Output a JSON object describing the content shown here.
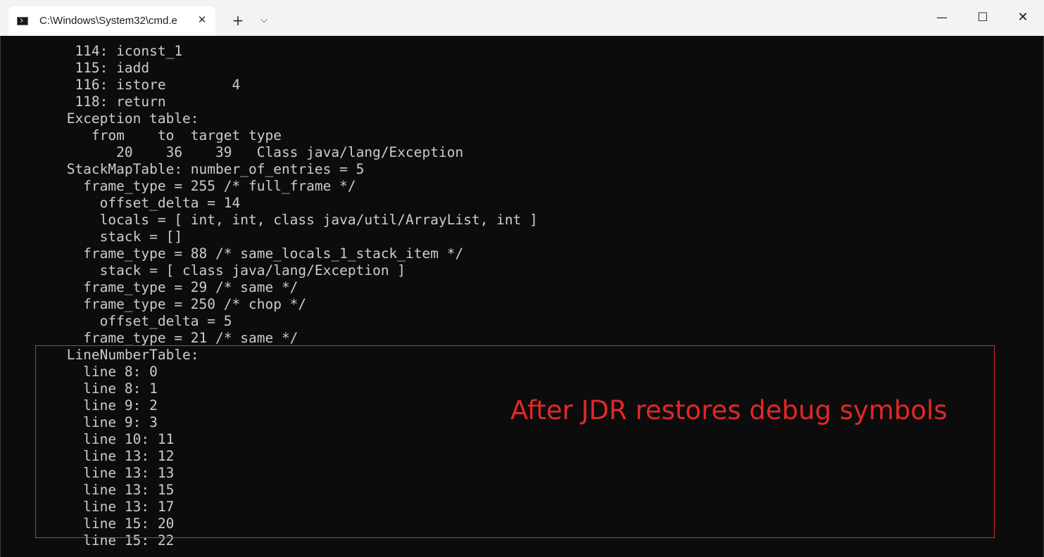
{
  "titlebar": {
    "tab_title": "C:\\Windows\\System32\\cmd.e",
    "tab_close_glyph": "✕",
    "new_tab_glyph": "+",
    "dropdown_glyph": "⌵",
    "minimize_glyph": "—",
    "maximize_glyph": "☐",
    "close_glyph": "✕"
  },
  "terminal": {
    "lines": [
      "      114: iconst_1",
      "      115: iadd",
      "      116: istore        4",
      "      118: return",
      "     Exception table:",
      "        from    to  target type",
      "           20    36    39   Class java/lang/Exception",
      "     StackMapTable: number_of_entries = 5",
      "       frame_type = 255 /* full_frame */",
      "         offset_delta = 14",
      "         locals = [ int, int, class java/util/ArrayList, int ]",
      "         stack = []",
      "       frame_type = 88 /* same_locals_1_stack_item */",
      "         stack = [ class java/lang/Exception ]",
      "       frame_type = 29 /* same */",
      "       frame_type = 250 /* chop */",
      "         offset_delta = 5",
      "       frame_type = 21 /* same */",
      "     LineNumberTable:",
      "       line 8: 0",
      "       line 8: 1",
      "       line 9: 2",
      "       line 9: 3",
      "       line 10: 11",
      "       line 13: 12",
      "       line 13: 13",
      "       line 13: 15",
      "       line 13: 17",
      "       line 15: 20",
      "       line 15: 22"
    ]
  },
  "annotation": {
    "text": "After JDR restores debug symbols",
    "color": "#e3262a"
  },
  "colors": {
    "terminal_bg": "#0c0c0c",
    "terminal_fg": "#cccccc",
    "titlebar_bg": "#f3f3f3",
    "tab_bg": "#ffffff",
    "highlight_border": "#e0292b"
  }
}
